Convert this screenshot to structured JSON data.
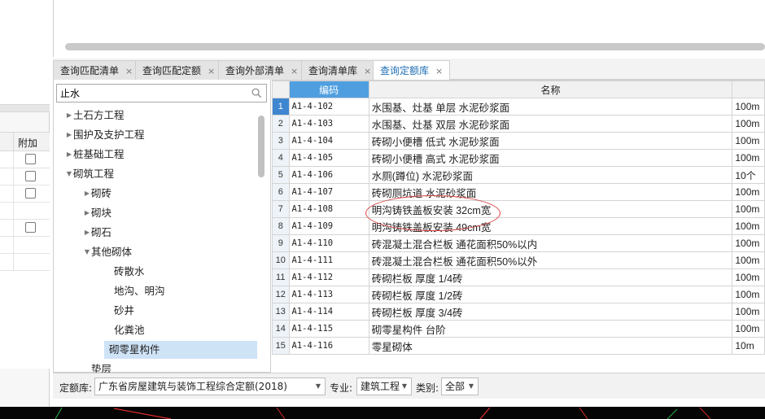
{
  "left_panel": {
    "header": "附加",
    "rows": [
      {
        "checkbox": true
      },
      {
        "checkbox": true
      },
      {
        "checkbox": true
      },
      {
        "checkbox": false
      },
      {
        "checkbox": true
      },
      {
        "checkbox": false
      },
      {
        "checkbox": false
      }
    ]
  },
  "tabs": [
    {
      "label": "查询匹配清单",
      "active": false
    },
    {
      "label": "查询匹配定额",
      "active": false
    },
    {
      "label": "查询外部清单",
      "active": false
    },
    {
      "label": "查询清单库",
      "active": false
    },
    {
      "label": "查询定额库",
      "active": true
    }
  ],
  "search": {
    "value": "止水"
  },
  "tree": [
    {
      "label": "土石方工程",
      "level": 0,
      "arrow": "right"
    },
    {
      "label": "围护及支护工程",
      "level": 0,
      "arrow": "right"
    },
    {
      "label": "桩基础工程",
      "level": 0,
      "arrow": "right"
    },
    {
      "label": "砌筑工程",
      "level": 0,
      "arrow": "down"
    },
    {
      "label": "砌砖",
      "level": 1,
      "arrow": "right"
    },
    {
      "label": "砌块",
      "level": 1,
      "arrow": "right"
    },
    {
      "label": "砌石",
      "level": 1,
      "arrow": "right"
    },
    {
      "label": "其他砌体",
      "level": 1,
      "arrow": "down"
    },
    {
      "label": "砖散水",
      "level": 2,
      "arrow": ""
    },
    {
      "label": "地沟、明沟",
      "level": 2,
      "arrow": ""
    },
    {
      "label": "砂井",
      "level": 2,
      "arrow": ""
    },
    {
      "label": "化粪池",
      "level": 2,
      "arrow": ""
    },
    {
      "label": "砌零星构件",
      "level": 2,
      "arrow": "",
      "selected": true
    },
    {
      "label": "垫层",
      "level": 1,
      "arrow": ""
    }
  ],
  "grid": {
    "columns": {
      "code": "编码",
      "name": "名称"
    },
    "rows": [
      {
        "num": "1",
        "code": "A1-4-102",
        "name": "水围基、灶基 单层 水泥砂浆面",
        "unit": "100m"
      },
      {
        "num": "2",
        "code": "A1-4-103",
        "name": "水围基、灶基 双层 水泥砂浆面",
        "unit": "100m"
      },
      {
        "num": "3",
        "code": "A1-4-104",
        "name": "砖砌小便槽 低式 水泥砂浆面",
        "unit": "100m"
      },
      {
        "num": "4",
        "code": "A1-4-105",
        "name": "砖砌小便槽 高式 水泥砂浆面",
        "unit": "100m"
      },
      {
        "num": "5",
        "code": "A1-4-106",
        "name": "水厕(蹲位) 水泥砂浆面",
        "unit": "10个"
      },
      {
        "num": "6",
        "code": "A1-4-107",
        "name": "砖砌厕坑道 水泥砂浆面",
        "unit": "100m"
      },
      {
        "num": "7",
        "code": "A1-4-108",
        "name": "明沟铸铁盖板安装 32cm宽",
        "unit": "100m"
      },
      {
        "num": "8",
        "code": "A1-4-109",
        "name": "明沟铸铁盖板安装 49cm宽",
        "unit": "100m"
      },
      {
        "num": "9",
        "code": "A1-4-110",
        "name": "砖混凝土混合栏板 通花面积50%以内",
        "unit": "100m"
      },
      {
        "num": "10",
        "code": "A1-4-111",
        "name": "砖混凝土混合栏板 通花面积50%以外",
        "unit": "100m"
      },
      {
        "num": "11",
        "code": "A1-4-112",
        "name": "砖砌栏板 厚度 1/4砖",
        "unit": "100m"
      },
      {
        "num": "12",
        "code": "A1-4-113",
        "name": "砖砌栏板 厚度 1/2砖",
        "unit": "100m"
      },
      {
        "num": "13",
        "code": "A1-4-114",
        "name": "砖砌栏板 厚度 3/4砖",
        "unit": "100m"
      },
      {
        "num": "14",
        "code": "A1-4-115",
        "name": "砌零星构件 台阶",
        "unit": "100m"
      },
      {
        "num": "15",
        "code": "A1-4-116",
        "name": "零星砌体",
        "unit": "10m"
      }
    ]
  },
  "bottom": {
    "quota_label": "定额库:",
    "quota_value": "广东省房屋建筑与装饰工程综合定额(2018)",
    "major_label": "专业:",
    "major_value": "建筑工程",
    "category_label": "类别:",
    "category_value": "全部"
  },
  "colors": {
    "accent": "#4f9fe0",
    "selected": "#cfe3f7",
    "annotation": "#d84040"
  }
}
